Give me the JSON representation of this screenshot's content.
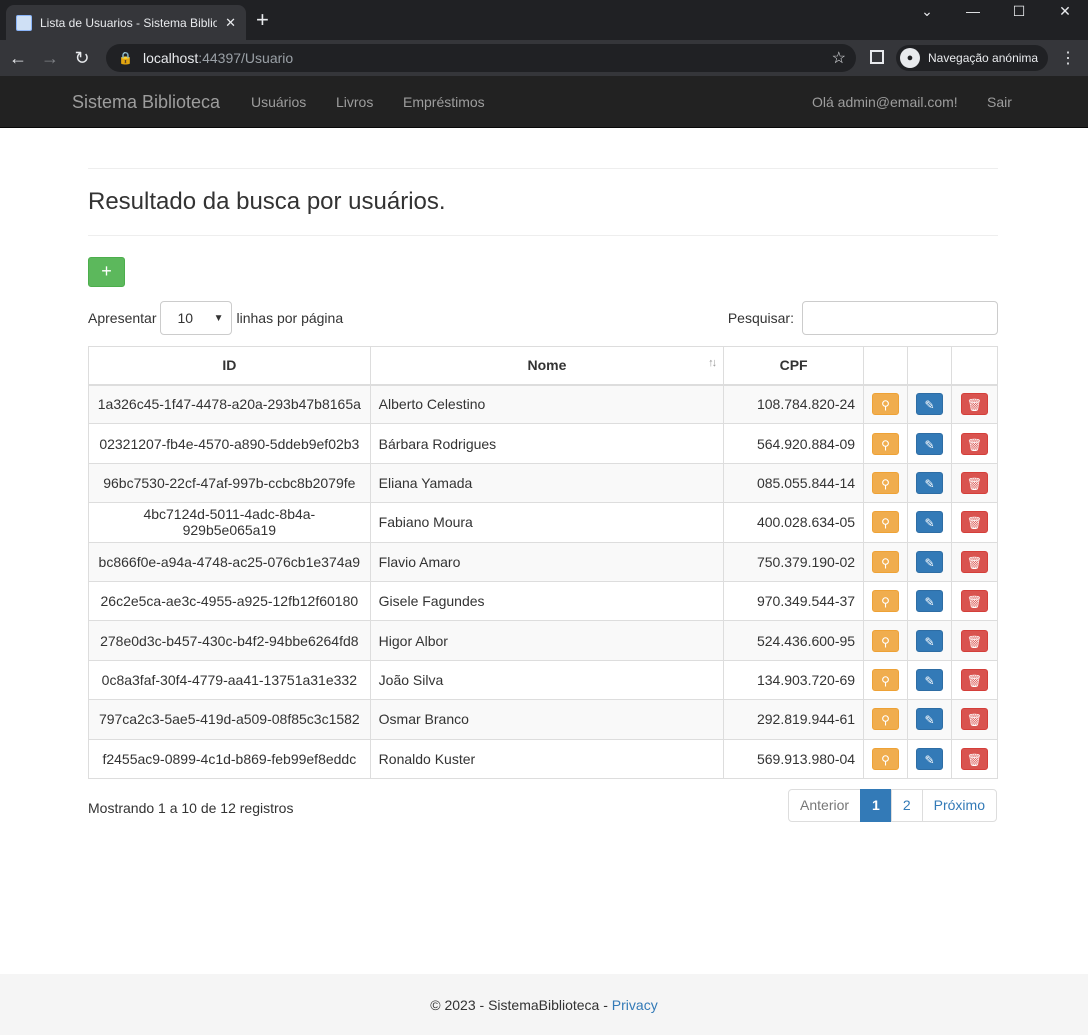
{
  "browser": {
    "tab_title": "Lista de Usuarios - Sistema Bibliote",
    "url_host": "localhost",
    "url_path": ":44397/Usuario",
    "incognito_label": "Navegação anónima"
  },
  "navbar": {
    "brand": "Sistema Biblioteca",
    "links": [
      "Usuários",
      "Livros",
      "Empréstimos"
    ],
    "greeting": "Olá admin@email.com!",
    "logout": "Sair"
  },
  "page": {
    "title": "Resultado da busca por usuários.",
    "add_button": "+"
  },
  "table_controls": {
    "show_label": "Apresentar",
    "page_length": "10",
    "rows_label": "linhas por página",
    "search_label": "Pesquisar:"
  },
  "table": {
    "columns": [
      "ID",
      "Nome",
      "CPF"
    ],
    "rows": [
      {
        "id": "1a326c45-1f47-4478-a20a-293b47b8165a",
        "nome": "Alberto Celestino",
        "cpf": "108.784.820-24"
      },
      {
        "id": "02321207-fb4e-4570-a890-5ddeb9ef02b3",
        "nome": "Bárbara Rodrigues",
        "cpf": "564.920.884-09"
      },
      {
        "id": "96bc7530-22cf-47af-997b-ccbc8b2079fe",
        "nome": "Eliana Yamada",
        "cpf": "085.055.844-14"
      },
      {
        "id": "4bc7124d-5011-4adc-8b4a-929b5e065a19",
        "nome": "Fabiano Moura",
        "cpf": "400.028.634-05"
      },
      {
        "id": "bc866f0e-a94a-4748-ac25-076cb1e374a9",
        "nome": "Flavio Amaro",
        "cpf": "750.379.190-02"
      },
      {
        "id": "26c2e5ca-ae3c-4955-a925-12fb12f60180",
        "nome": "Gisele Fagundes",
        "cpf": "970.349.544-37"
      },
      {
        "id": "278e0d3c-b457-430c-b4f2-94bbe6264fd8",
        "nome": "Higor Albor",
        "cpf": "524.436.600-95"
      },
      {
        "id": "0c8a3faf-30f4-4779-aa41-13751a31e332",
        "nome": "João Silva",
        "cpf": "134.903.720-69"
      },
      {
        "id": "797ca2c3-5ae5-419d-a509-08f85c3c1582",
        "nome": "Osmar Branco",
        "cpf": "292.819.944-61"
      },
      {
        "id": "f2455ac9-0899-4c1d-b869-feb99ef8eddc",
        "nome": "Ronaldo Kuster",
        "cpf": "569.913.980-04"
      }
    ]
  },
  "pagination": {
    "info": "Mostrando 1 a 10 de 12 registros",
    "previous": "Anterior",
    "pages": [
      "1",
      "2"
    ],
    "next": "Próximo"
  },
  "footer": {
    "text": "© 2023 - SistemaBiblioteca - ",
    "link": "Privacy"
  },
  "colors": {
    "success": "#5cb85c",
    "warning": "#f0ad4e",
    "primary": "#337ab7",
    "danger": "#d9534f",
    "navbar": "#222222"
  }
}
